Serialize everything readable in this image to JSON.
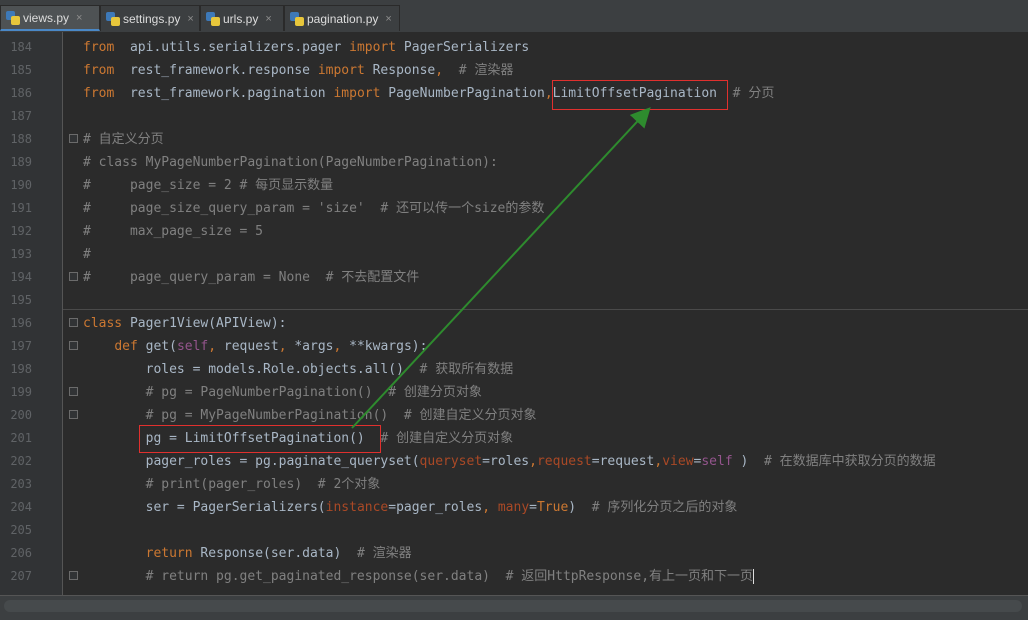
{
  "tabs": [
    {
      "label": "views.py",
      "active": true
    },
    {
      "label": "settings.py",
      "active": false
    },
    {
      "label": "urls.py",
      "active": false
    },
    {
      "label": "pagination.py",
      "active": false
    }
  ],
  "tab_close": "×",
  "lines": [
    {
      "n": "184",
      "segs": [
        [
          "kw",
          "from"
        ],
        [
          "",
          "  api.utils.serializers.pager "
        ],
        [
          "kw",
          "import"
        ],
        [
          "",
          " PagerSerializers"
        ]
      ]
    },
    {
      "n": "185",
      "segs": [
        [
          "kw",
          "from"
        ],
        [
          "",
          "  rest_framework.response "
        ],
        [
          "kw",
          "import"
        ],
        [
          "",
          " Response"
        ],
        [
          "kw",
          ","
        ],
        [
          "cm",
          "  # 渲染器"
        ]
      ]
    },
    {
      "n": "186",
      "segs": [
        [
          "kw",
          "from"
        ],
        [
          "",
          "  rest_framework.pagination "
        ],
        [
          "kw",
          "import"
        ],
        [
          "",
          " PageNumberPagination"
        ],
        [
          "kw",
          ","
        ],
        [
          "",
          "LimitOffsetPagination"
        ],
        [
          "cm",
          "  # 分页"
        ]
      ]
    },
    {
      "n": "187",
      "segs": []
    },
    {
      "n": "188",
      "segs": [
        [
          "cm",
          "# 自定义分页"
        ]
      ]
    },
    {
      "n": "189",
      "segs": [
        [
          "cm",
          "# class MyPageNumberPagination(PageNumberPagination):"
        ]
      ]
    },
    {
      "n": "190",
      "segs": [
        [
          "cm",
          "#     page_size = 2 # 每页显示数量"
        ]
      ]
    },
    {
      "n": "191",
      "segs": [
        [
          "cm",
          "#     page_size_query_param = 'size'  # 还可以传一个size的参数"
        ]
      ]
    },
    {
      "n": "192",
      "segs": [
        [
          "cm",
          "#     max_page_size = 5"
        ]
      ]
    },
    {
      "n": "193",
      "segs": [
        [
          "cm",
          "#"
        ]
      ]
    },
    {
      "n": "194",
      "segs": [
        [
          "cm",
          "#     page_query_param = None  # 不去配置文件"
        ]
      ]
    },
    {
      "n": "195",
      "segs": []
    },
    {
      "n": "196",
      "segs": [
        [
          "kw",
          "class"
        ],
        [
          "",
          " Pager1View(APIView):"
        ]
      ]
    },
    {
      "n": "197",
      "segs": [
        [
          "",
          "    "
        ],
        [
          "kw",
          "def"
        ],
        [
          "",
          " get("
        ],
        [
          "self",
          "self"
        ],
        [
          "kw",
          ","
        ],
        [
          "",
          " request"
        ],
        [
          "kw",
          ","
        ],
        [
          "",
          " *args"
        ],
        [
          "kw",
          ","
        ],
        [
          "",
          " **kwargs):"
        ]
      ]
    },
    {
      "n": "198",
      "segs": [
        [
          "",
          "        roles = models.Role.objects.all()"
        ],
        [
          "cm",
          "  # 获取所有数据"
        ]
      ]
    },
    {
      "n": "199",
      "segs": [
        [
          "cm",
          "        # pg = PageNumberPagination()  # 创建分页对象"
        ]
      ]
    },
    {
      "n": "200",
      "segs": [
        [
          "cm",
          "        # pg = MyPageNumberPagination()  # 创建自定义分页对象"
        ]
      ]
    },
    {
      "n": "201",
      "segs": [
        [
          "",
          "        pg = LimitOffsetPagination()"
        ],
        [
          "cm",
          "  # 创建自定义分页对象"
        ]
      ]
    },
    {
      "n": "202",
      "segs": [
        [
          "",
          "        pager_roles = pg.paginate_queryset("
        ],
        [
          "param",
          "queryset"
        ],
        [
          "",
          "=roles"
        ],
        [
          "kw",
          ","
        ],
        [
          "param",
          "request"
        ],
        [
          "",
          "=request"
        ],
        [
          "kw",
          ","
        ],
        [
          "param",
          "view"
        ],
        [
          "",
          "="
        ],
        [
          "self",
          "self"
        ],
        [
          "",
          " )"
        ],
        [
          "cm",
          "  # 在数据库中获取分页的数据"
        ]
      ]
    },
    {
      "n": "203",
      "segs": [
        [
          "cm",
          "        # print(pager_roles)  # 2个对象"
        ]
      ]
    },
    {
      "n": "204",
      "segs": [
        [
          "",
          "        ser = PagerSerializers("
        ],
        [
          "param",
          "instance"
        ],
        [
          "",
          "=pager_roles"
        ],
        [
          "kw",
          ","
        ],
        [
          "",
          " "
        ],
        [
          "param",
          "many"
        ],
        [
          "",
          "="
        ],
        [
          "kw",
          "True"
        ],
        [
          "",
          ")"
        ],
        [
          "cm",
          "  # 序列化分页之后的对象"
        ]
      ]
    },
    {
      "n": "205",
      "segs": []
    },
    {
      "n": "206",
      "segs": [
        [
          "",
          "        "
        ],
        [
          "kw",
          "return"
        ],
        [
          "",
          " Response(ser.data)"
        ],
        [
          "cm",
          "  # 渲染器"
        ]
      ]
    },
    {
      "n": "207",
      "segs": [
        [
          "cm",
          "        # return pg.get_paginated_response(ser.data)  # 返回HttpResponse,有上一页和下一页"
        ]
      ]
    }
  ],
  "colors": {
    "keyword": "#cc7832",
    "comment": "#808080",
    "text": "#a9b7c6",
    "annotation_red": "#e0302e",
    "arrow_green": "#2e8b2e"
  }
}
